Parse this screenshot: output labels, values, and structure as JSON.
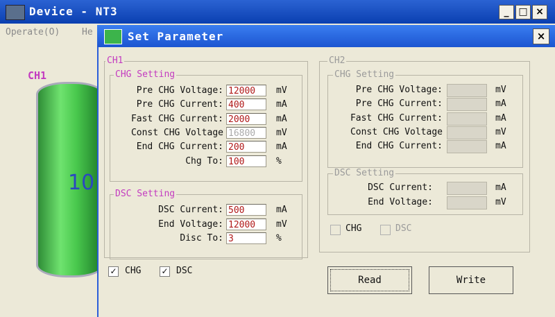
{
  "main_window": {
    "title": "Device - NT3",
    "menu": [
      "Operate(O)",
      "He"
    ],
    "ch1_label": "CH1",
    "battery_text": "10"
  },
  "dialog": {
    "title": "Set Parameter",
    "close_glyph": "×",
    "ch1": {
      "group_label": "CH1",
      "chg_setting": {
        "label": "CHG Setting",
        "rows": [
          {
            "label": "Pre CHG Voltage:",
            "value": "12000",
            "unit": "mV"
          },
          {
            "label": "Pre CHG Current:",
            "value": "400",
            "unit": "mA"
          },
          {
            "label": "Fast CHG Current:",
            "value": "2000",
            "unit": "mA"
          },
          {
            "label": "Const CHG Voltage",
            "value": "16800",
            "unit": "mV"
          },
          {
            "label": "End CHG Current:",
            "value": "200",
            "unit": "mA"
          },
          {
            "label": "Chg To:",
            "value": "100",
            "unit": "%"
          }
        ]
      },
      "dsc_setting": {
        "label": "DSC Setting",
        "rows": [
          {
            "label": "DSC Current:",
            "value": "500",
            "unit": "mA"
          },
          {
            "label": "End Voltage:",
            "value": "12000",
            "unit": "mV"
          },
          {
            "label": "Disc To:",
            "value": "3",
            "unit": "%"
          }
        ]
      },
      "checks": [
        {
          "label": "CHG",
          "checked": true
        },
        {
          "label": "DSC",
          "checked": true
        }
      ]
    },
    "ch2": {
      "group_label": "CH2",
      "chg_setting": {
        "label": "CHG Setting",
        "rows": [
          {
            "label": "Pre CHG Voltage:",
            "value": "",
            "unit": "mV"
          },
          {
            "label": "Pre CHG Current:",
            "value": "",
            "unit": "mA"
          },
          {
            "label": "Fast CHG Current:",
            "value": "",
            "unit": "mA"
          },
          {
            "label": "Const CHG Voltage",
            "value": "",
            "unit": "mV"
          },
          {
            "label": "End CHG Current:",
            "value": "",
            "unit": "mA"
          }
        ]
      },
      "dsc_setting": {
        "label": "DSC Setting",
        "rows": [
          {
            "label": "DSC Current:",
            "value": "",
            "unit": "mA"
          },
          {
            "label": "End Voltage:",
            "value": "",
            "unit": "mV"
          }
        ]
      },
      "checks": [
        {
          "label": "CHG",
          "checked": false
        },
        {
          "label": "DSC",
          "checked": false
        }
      ]
    },
    "buttons": {
      "read": "Read",
      "write": "Write"
    },
    "check_glyph": "✓"
  },
  "colors": {
    "titlebar": "#1c55d1",
    "value_text": "#b01818",
    "group_label": "#c33bc0"
  }
}
